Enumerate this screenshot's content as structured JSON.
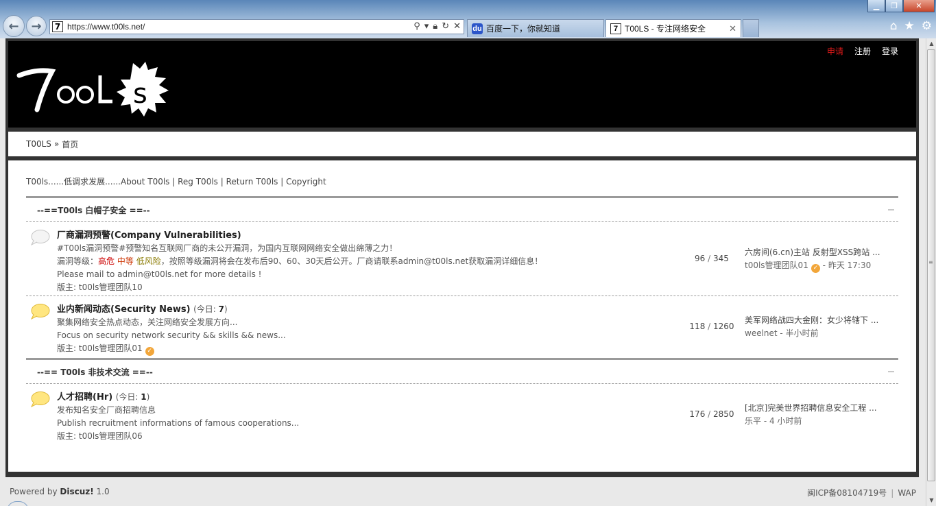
{
  "browser": {
    "url": "https://www.t00ls.net/",
    "tabs": [
      {
        "title": "百度一下，你就知道",
        "favicon": "baidu-paw-icon"
      },
      {
        "title": "T00LS - 专注网络安全",
        "favicon": "t-icon"
      }
    ],
    "tab_close_glyph": "✕",
    "favicon_letter": "7"
  },
  "header": {
    "logo_text": "7OOLS",
    "links": {
      "apply": "申请",
      "register": "注册",
      "login": "登录"
    }
  },
  "breadcrumb": {
    "site": "T00LS",
    "sep": "»",
    "current": "首页"
  },
  "announce": "T00ls......低调求发展......About T00ls | Reg T00ls | Return T00ls | Copyright",
  "categories": [
    {
      "title": "--==T00ls 白帽子安全 ==--",
      "forums": [
        {
          "name": "厂商漏洞预警(Company Vulnerabilities)",
          "desc1": "#T00ls漏洞预警#预警知名互联网厂商的未公开漏洞，为国内互联网网络安全做出绵薄之力！",
          "desc2_prefix": "漏洞等级：",
          "level_high": "高危",
          "level_mid": "中等",
          "level_low": "低风险",
          "desc2_suffix": "，按照等级漏洞将会在发布后90、60、30天后公开。厂商请联系admin@t00ls.net获取漏洞详细信息！",
          "desc3": "Please mail to admin@t00ls.net for more details !",
          "moderator": "版主: t00ls管理团队10",
          "threads": "96",
          "posts": "345",
          "last_title": "六房间(6.cn)主站 反射型XSS跨站 ...",
          "last_meta": "t00ls管理团队01",
          "last_time": "- 昨天 17:30"
        },
        {
          "name": "业内新闻动态(Security News)",
          "today_label": "(今日: ",
          "today_count": "7",
          "today_close": ")",
          "desc1": "聚集网络安全热点动态，关注网络安全发展方向...",
          "desc2": "Focus on security network security && skills && news...",
          "moderator": "版主: t00ls管理团队01",
          "threads": "118",
          "posts": "1260",
          "last_title": "美军网络战四大金刚：女少将辖下 ...",
          "last_meta": "weelnet - 半小时前"
        }
      ]
    },
    {
      "title": "--== T00ls 非技术交流 ==--",
      "forums": [
        {
          "name": "人才招聘(Hr)",
          "today_label": "(今日: ",
          "today_count": "1",
          "today_close": ")",
          "desc1": "发布知名安全厂商招聘信息",
          "desc2": "Publish recruitment informations of famous cooperations...",
          "moderator": "版主: t00ls管理团队06",
          "threads": "176",
          "posts": "2850",
          "last_title": "[北京]完美世界招聘信息安全工程 ...",
          "last_meta": "乐平 - 4 小时前"
        }
      ]
    }
  ],
  "footer": {
    "powered": "Powered by ",
    "brand": "Discuz!",
    "version": " 1.0",
    "icp": "闽ICP备08104719号",
    "wap": "WAP",
    "divider": "|"
  },
  "count_sep": "/",
  "colors": {
    "accent_red": "#e01a1a",
    "level_high": "#cc0000",
    "level_mid": "#cc3300",
    "level_low": "#8a7a00"
  }
}
